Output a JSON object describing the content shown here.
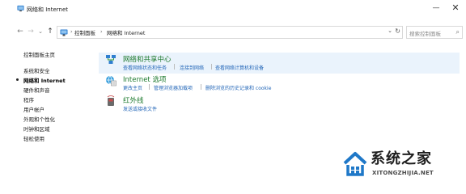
{
  "window": {
    "title": "网络和 Internet",
    "minimize_glyph": "—",
    "close_glyph": "✕"
  },
  "nav": {
    "back_glyph": "←",
    "forward_glyph": "→",
    "history_glyph": "⌄",
    "up_glyph": "↑",
    "breadcrumb": [
      "控制面板",
      "网络和 Internet"
    ],
    "crumb_separator": "›",
    "search_placeholder": "搜索控制面板"
  },
  "sidebar": {
    "items": [
      {
        "label": "控制面板主页",
        "current": false
      },
      {
        "label": "系统和安全",
        "current": false
      },
      {
        "label": "网络和 Internet",
        "current": true
      },
      {
        "label": "硬件和声音",
        "current": false
      },
      {
        "label": "程序",
        "current": false
      },
      {
        "label": "用户帐户",
        "current": false
      },
      {
        "label": "外观和个性化",
        "current": false
      },
      {
        "label": "时钟和区域",
        "current": false
      },
      {
        "label": "轻松使用",
        "current": false
      }
    ]
  },
  "categories": [
    {
      "title": "网络和共享中心",
      "icon": "network-sharing-icon",
      "links": [
        "查看网络状态和任务",
        "连接到网络",
        "查看网络计算机和设备"
      ]
    },
    {
      "title": "Internet 选项",
      "icon": "internet-options-icon",
      "links": [
        "更改主页",
        "管理浏览器加载项",
        "删除浏览的历史记录和 cookie"
      ]
    },
    {
      "title": "红外线",
      "icon": "infrared-icon",
      "links": [
        "发送或接收文件"
      ]
    }
  ],
  "watermark": {
    "cn": "系统之家",
    "en": "XITONGZHIJIA.NET"
  },
  "colors": {
    "category_title": "#1e7a2e",
    "link": "#2467b8",
    "highlight": "#eaf3fc"
  }
}
